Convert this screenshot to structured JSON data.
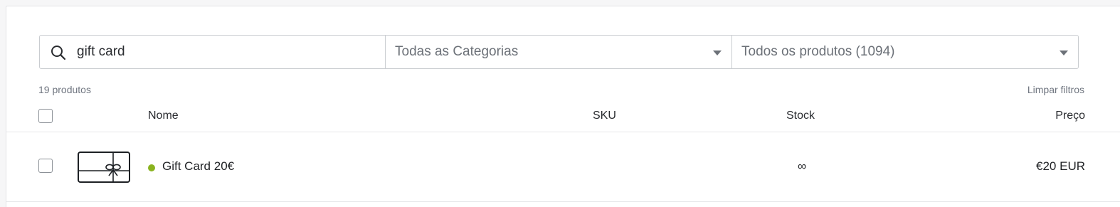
{
  "search": {
    "value": "gift card",
    "icon": "search-icon"
  },
  "filters": {
    "category": "Todas as Categorias",
    "products": "Todos os produtos (1094)"
  },
  "summary": {
    "count_label": "19 produtos",
    "clear_label": "Limpar filtros"
  },
  "table": {
    "headers": {
      "name": "Nome",
      "sku": "SKU",
      "stock": "Stock",
      "price": "Preço"
    },
    "rows": [
      {
        "name": "Gift Card 20€",
        "sku": "",
        "stock": "∞",
        "price": "€20 EUR",
        "status_color": "#8ab31f",
        "thumbnail_icon": "gift-card-icon"
      }
    ]
  }
}
